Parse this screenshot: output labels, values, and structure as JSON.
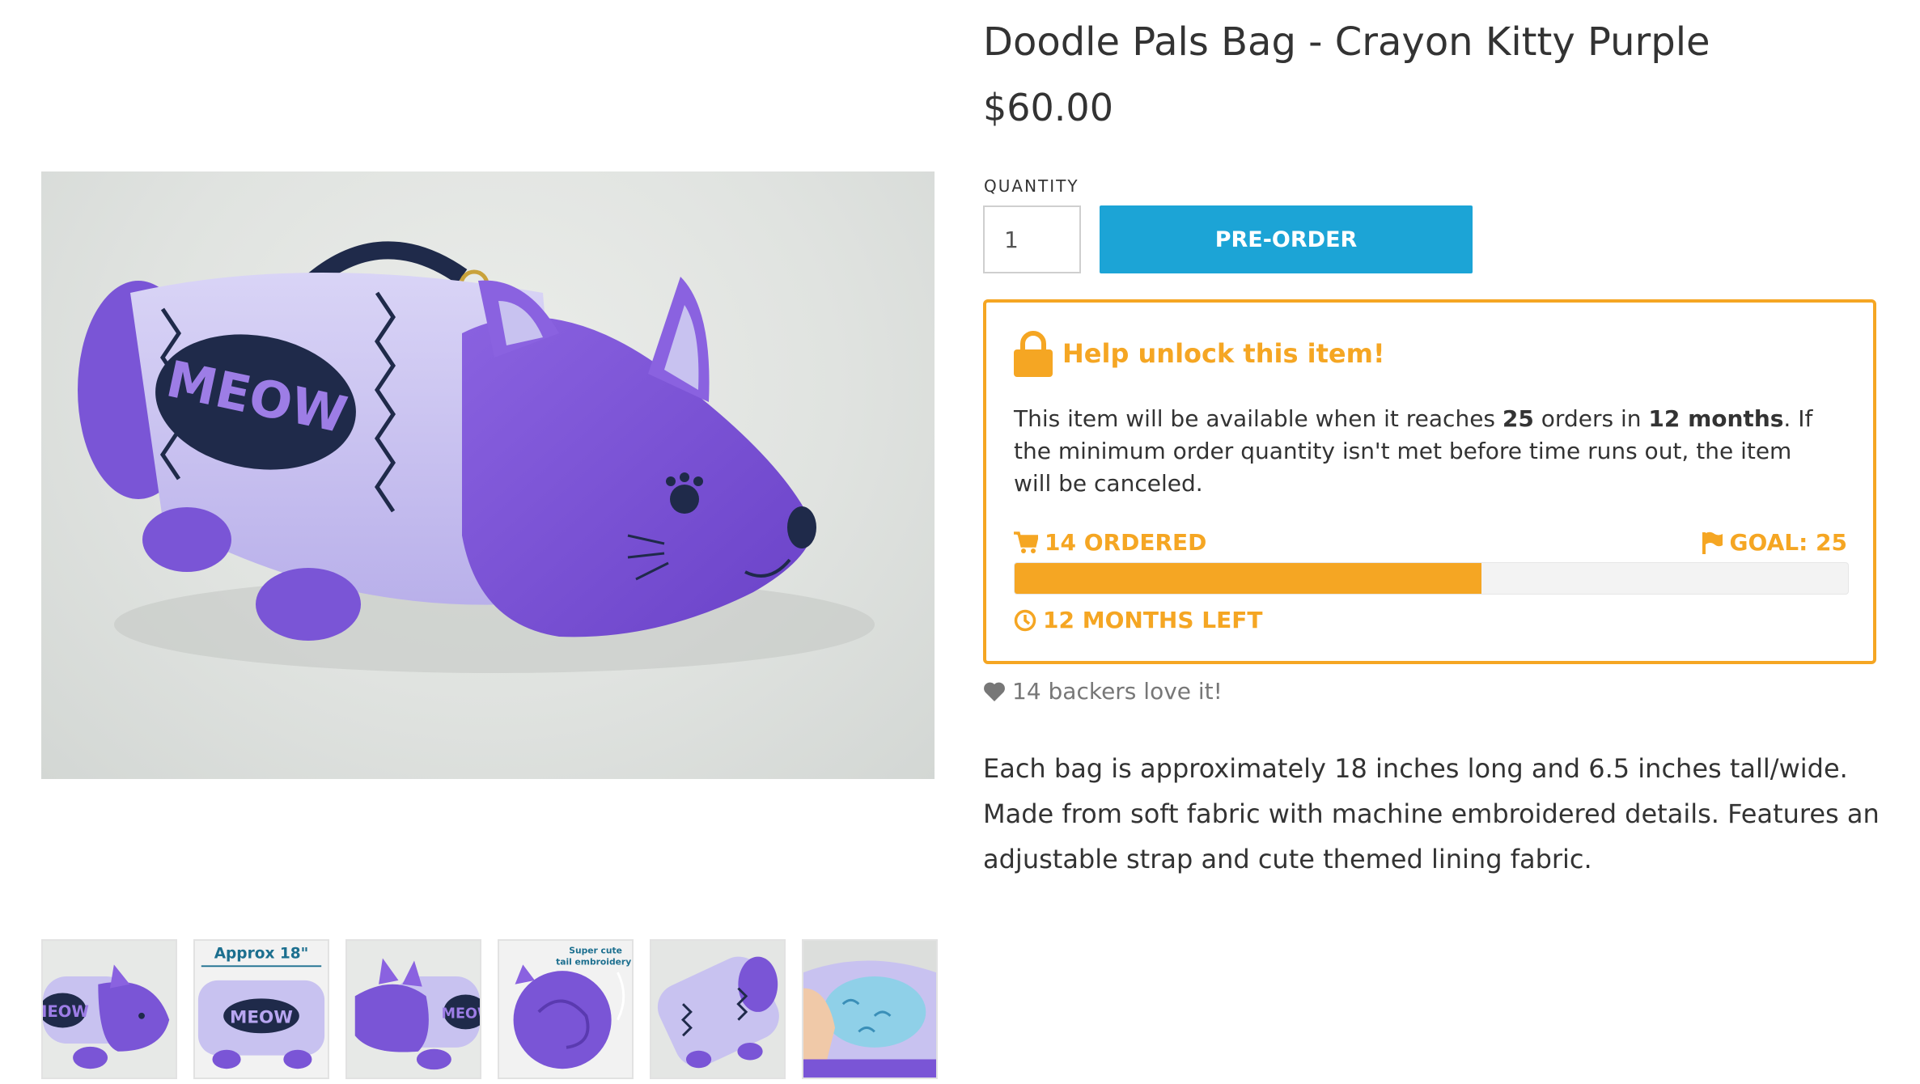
{
  "product": {
    "title": "Doodle Pals Bag - Crayon Kitty Purple",
    "price": "$60.00",
    "image_alt": "Crayon Kitty Purple plush bag",
    "main_image_text": "MEOW",
    "description": "Each bag is approximately 18 inches long and 6.5 inches tall/wide. Made from soft fabric with machine embroidered details. Features an adjustable strap and cute themed lining fabric."
  },
  "purchase": {
    "quantity_label": "QUANTITY",
    "quantity_value": "1",
    "button_label": "PRE-ORDER"
  },
  "unlock": {
    "title": "Help unlock this item!",
    "desc_prefix": "This item will be available when it reaches ",
    "goal_number": "25",
    "desc_mid": " orders in ",
    "duration": "12 months",
    "desc_suffix": ". If the minimum order quantity isn't met before time runs out, the item will be canceled.",
    "ordered_label": "14 ORDERED",
    "goal_label": "GOAL: 25",
    "time_left_label": "12 MONTHS LEFT",
    "ordered": 14,
    "goal": 25,
    "progress_fraction": 0.56
  },
  "backers": {
    "label": "14 backers love it!"
  },
  "thumbnails": [
    {
      "kind": "front",
      "text": "MEOW"
    },
    {
      "kind": "size",
      "text": "MEOW",
      "caption": "Approx 18\""
    },
    {
      "kind": "side",
      "text": "MEOW"
    },
    {
      "kind": "tail",
      "caption_line1": "Super cute",
      "caption_line2": "tail embroidery!"
    },
    {
      "kind": "bottom"
    },
    {
      "kind": "lining"
    }
  ],
  "colors": {
    "accent_orange": "#f5a623",
    "button_blue": "#1ca4d6",
    "plush_purple": "#7a55d6",
    "plush_lavender": "#c8c2f0",
    "patch_navy": "#1f2a4a"
  },
  "icons": {
    "lock": "lock-icon",
    "cart": "cart-icon",
    "flag": "flag-icon",
    "clock": "clock-icon",
    "heart": "heart-icon"
  }
}
